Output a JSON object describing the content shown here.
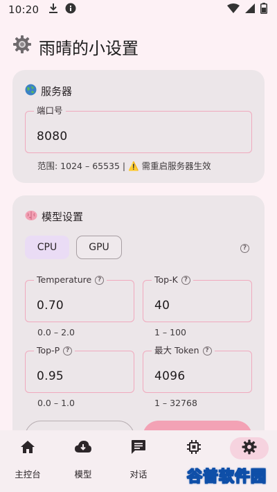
{
  "status_bar": {
    "time": "10:20"
  },
  "app": {
    "title": "雨晴的小设置"
  },
  "server": {
    "section_title": "服务器",
    "port_label": "端口号",
    "port_value": "8080",
    "hint": "范围: 1024 – 65535 | ⚠️ 需重启服务器生效"
  },
  "model": {
    "section_title": "模型设置",
    "devices": [
      "CPU",
      "GPU"
    ],
    "selected_device": "CPU",
    "temperature": {
      "label": "Temperature",
      "value": "0.70",
      "range": "0.0 – 2.0"
    },
    "top_k": {
      "label": "Top-K",
      "value": "40",
      "range": "1 – 100"
    },
    "top_p": {
      "label": "Top-P",
      "value": "0.95",
      "range": "0.0 – 1.0"
    },
    "max_token": {
      "label": "最大 Token",
      "value": "4096",
      "range": "1 – 32768"
    }
  },
  "nav": {
    "items": [
      {
        "label": "主控台",
        "icon": "home-icon"
      },
      {
        "label": "模型",
        "icon": "cloud-download-icon"
      },
      {
        "label": "对话",
        "icon": "chat-icon"
      },
      {
        "label": "",
        "icon": "chip-icon"
      },
      {
        "label": "",
        "icon": "gear-icon"
      }
    ],
    "active_index": 4
  },
  "watermark": {
    "text": "谷普软件园"
  },
  "colors": {
    "background": "#fdf1f5",
    "card": "#ece6e9",
    "accent_border": "#f0a9bd",
    "selected_chip": "#eadcf5",
    "active_nav": "#f6d3df",
    "primary_button": "#f3a2b5"
  }
}
